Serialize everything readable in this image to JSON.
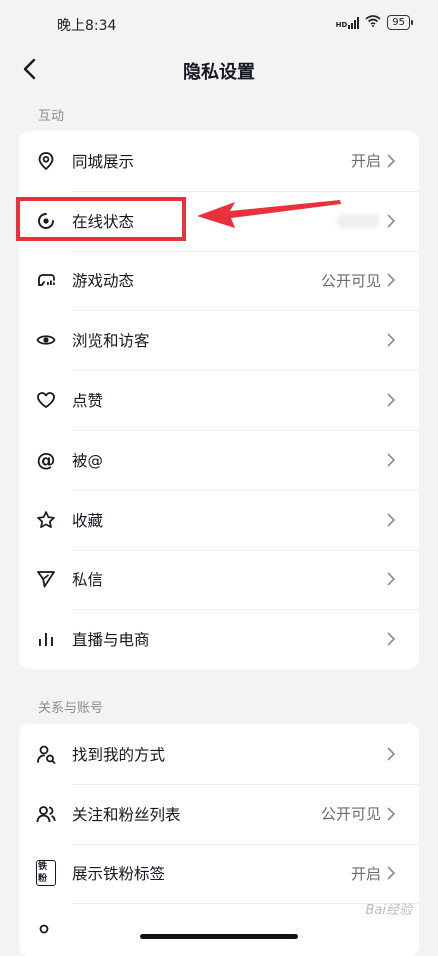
{
  "status_bar": {
    "time": "晚上8:34",
    "hd": "HD",
    "battery": "95"
  },
  "header": {
    "title": "隐私设置"
  },
  "sections": [
    {
      "label": "互动",
      "items": [
        {
          "label": "同城展示",
          "value": "开启",
          "icon": "location-pin-icon"
        },
        {
          "label": "在线状态",
          "value": "",
          "icon": "online-status-icon"
        },
        {
          "label": "游戏动态",
          "value": "公开可见",
          "icon": "game-controller-icon"
        },
        {
          "label": "浏览和访客",
          "value": "",
          "icon": "eye-icon"
        },
        {
          "label": "点赞",
          "value": "",
          "icon": "heart-icon"
        },
        {
          "label": "被@",
          "value": "",
          "icon": "at-icon"
        },
        {
          "label": "收藏",
          "value": "",
          "icon": "star-icon"
        },
        {
          "label": "私信",
          "value": "",
          "icon": "send-icon"
        },
        {
          "label": "直播与电商",
          "value": "",
          "icon": "bars-icon"
        }
      ]
    },
    {
      "label": "关系与账号",
      "items": [
        {
          "label": "找到我的方式",
          "value": "",
          "icon": "find-user-icon"
        },
        {
          "label": "关注和粉丝列表",
          "value": "公开可见",
          "icon": "users-icon"
        },
        {
          "label": "展示铁粉标签",
          "value": "开启",
          "icon": "fan-badge-icon",
          "badge_text": "铁粉"
        }
      ]
    }
  ],
  "annotation": {
    "highlight_color": "#e8313a"
  },
  "watermark": "Bai经验",
  "colors": {
    "background": "#f3f3f3",
    "card": "#ffffff",
    "text": "#161823",
    "secondary": "#6b6c72",
    "accent_red": "#e8313a"
  }
}
